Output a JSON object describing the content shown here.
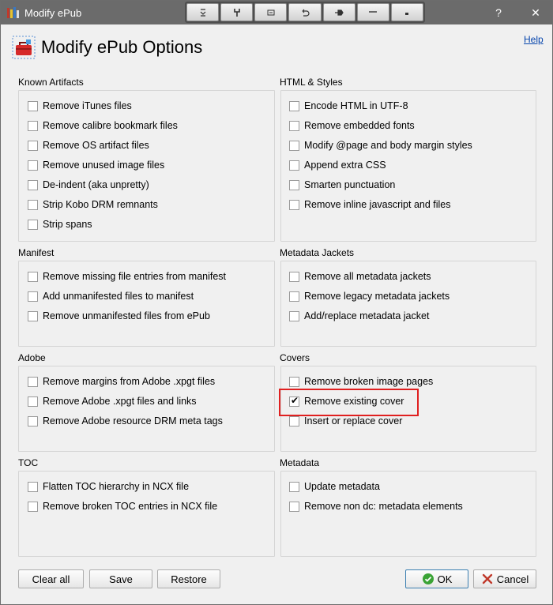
{
  "window": {
    "title": "Modify ePub",
    "controls": {
      "help": "?",
      "close": "✕"
    }
  },
  "toolbar": {
    "buttons": [
      "collapse-icon",
      "wrench-icon",
      "window-icon",
      "undo-icon",
      "pin-icon",
      "minimize-line-icon",
      "dot-icon"
    ]
  },
  "header": {
    "title": "Modify ePub Options",
    "help": "Help"
  },
  "groups": {
    "known_artifacts": {
      "label": "Known Artifacts",
      "options": [
        {
          "label": "Remove iTunes files",
          "checked": false
        },
        {
          "label": "Remove calibre bookmark files",
          "checked": false
        },
        {
          "label": "Remove OS artifact files",
          "checked": false
        },
        {
          "label": "Remove unused image files",
          "checked": false
        },
        {
          "label": "De-indent (aka unpretty)",
          "checked": false
        },
        {
          "label": "Strip Kobo DRM remnants",
          "checked": false
        },
        {
          "label": "Strip spans",
          "checked": false
        }
      ]
    },
    "html_styles": {
      "label": "HTML & Styles",
      "options": [
        {
          "label": "Encode HTML in UTF-8",
          "checked": false
        },
        {
          "label": "Remove embedded fonts",
          "checked": false
        },
        {
          "label": "Modify @page and body margin styles",
          "checked": false
        },
        {
          "label": "Append extra CSS",
          "checked": false
        },
        {
          "label": "Smarten punctuation",
          "checked": false
        },
        {
          "label": "Remove inline javascript and files",
          "checked": false
        }
      ]
    },
    "manifest": {
      "label": "Manifest",
      "options": [
        {
          "label": "Remove missing file entries from manifest",
          "checked": false
        },
        {
          "label": "Add unmanifested files to manifest",
          "checked": false
        },
        {
          "label": "Remove unmanifested files from ePub",
          "checked": false
        }
      ]
    },
    "metadata_jackets": {
      "label": "Metadata Jackets",
      "options": [
        {
          "label": "Remove all metadata jackets",
          "checked": false
        },
        {
          "label": "Remove legacy metadata jackets",
          "checked": false
        },
        {
          "label": "Add/replace metadata jacket",
          "checked": false
        }
      ]
    },
    "adobe": {
      "label": "Adobe",
      "options": [
        {
          "label": "Remove margins from Adobe .xpgt files",
          "checked": false
        },
        {
          "label": "Remove Adobe .xpgt files and links",
          "checked": false
        },
        {
          "label": "Remove Adobe resource DRM meta tags",
          "checked": false
        }
      ]
    },
    "covers": {
      "label": "Covers",
      "options": [
        {
          "label": "Remove broken image pages",
          "checked": false
        },
        {
          "label": "Remove existing cover",
          "checked": true
        },
        {
          "label": "Insert or replace cover",
          "checked": false
        }
      ]
    },
    "toc": {
      "label": "TOC",
      "options": [
        {
          "label": "Flatten TOC hierarchy in NCX file",
          "checked": false
        },
        {
          "label": "Remove broken TOC entries in NCX file",
          "checked": false
        }
      ]
    },
    "metadata": {
      "label": "Metadata",
      "options": [
        {
          "label": "Update metadata",
          "checked": false
        },
        {
          "label": "Remove non dc: metadata elements",
          "checked": false
        }
      ]
    }
  },
  "buttons": {
    "clear_all": "Clear all",
    "save": "Save",
    "restore": "Restore",
    "ok": "OK",
    "cancel": "Cancel"
  },
  "colors": {
    "titlebar": "#6b6b6b",
    "highlight": "#e02020",
    "link": "#0645ad",
    "ok_green": "#3aa335",
    "cancel_red": "#c0392b"
  }
}
